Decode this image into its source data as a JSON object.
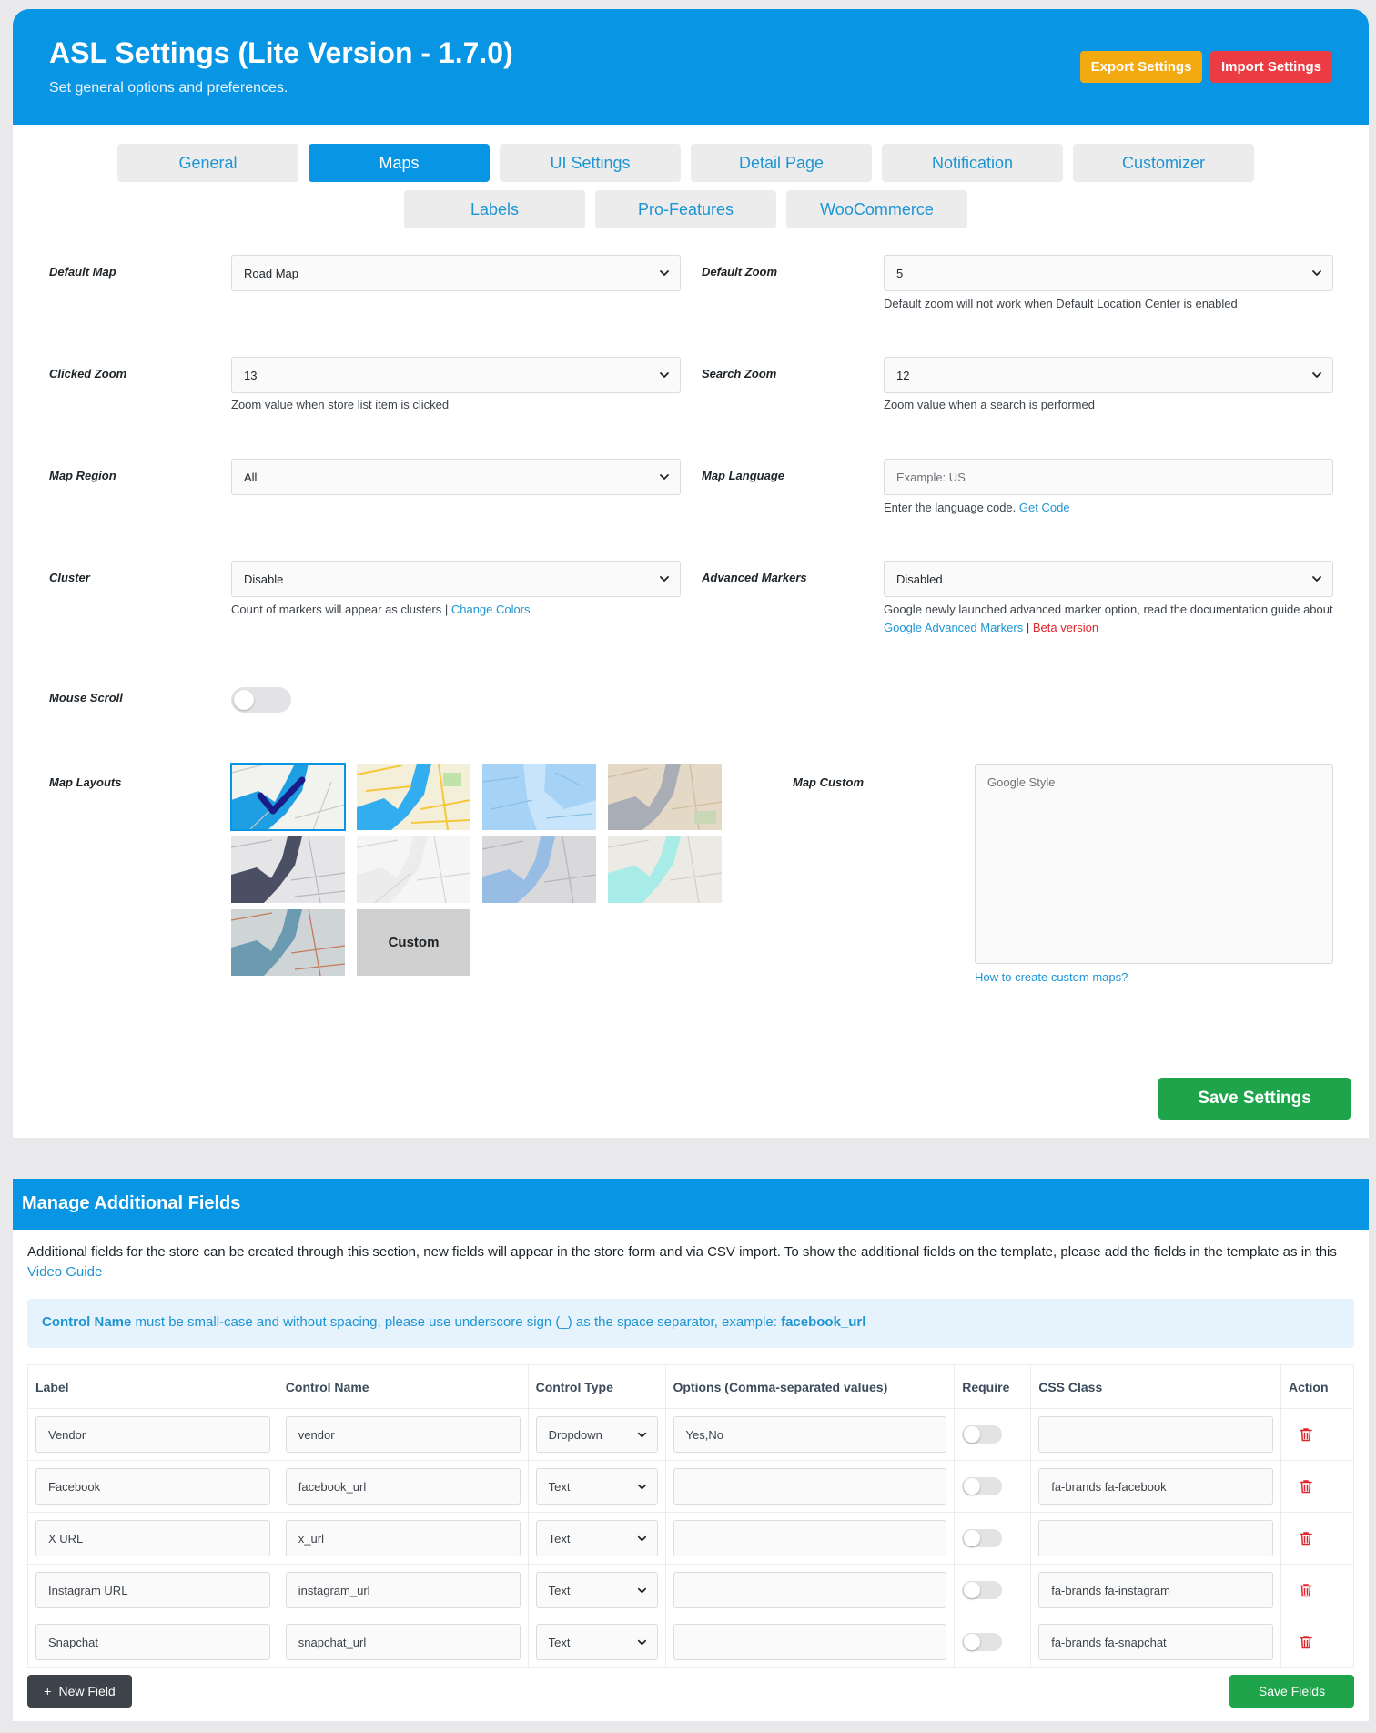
{
  "header": {
    "title": "ASL Settings (Lite Version - 1.7.0)",
    "subtitle": "Set general options and preferences.",
    "export_label": "Export Settings",
    "import_label": "Import Settings",
    "colors": {
      "primary": "#0895e3",
      "export": "#f2aa10",
      "import": "#eb3b43"
    }
  },
  "tabs": {
    "row1": [
      "General",
      "Maps",
      "UI Settings",
      "Detail Page",
      "Notification",
      "Customizer"
    ],
    "row2": [
      "Labels",
      "Pro-Features",
      "WooCommerce"
    ],
    "active": "Maps"
  },
  "maps": {
    "default_map": {
      "label": "Default Map",
      "value": "Road Map"
    },
    "default_zoom": {
      "label": "Default Zoom",
      "value": "5",
      "help": "Default zoom will not work when Default Location Center is enabled"
    },
    "clicked_zoom": {
      "label": "Clicked Zoom",
      "value": "13",
      "help": "Zoom value when store list item is clicked"
    },
    "search_zoom": {
      "label": "Search Zoom",
      "value": "12",
      "help": "Zoom value when a search is performed"
    },
    "map_region": {
      "label": "Map Region",
      "value": "All"
    },
    "map_language": {
      "label": "Map Language",
      "placeholder": "Example: US",
      "help": "Enter the language code.",
      "help_link": "Get Code"
    },
    "cluster": {
      "label": "Cluster",
      "value": "Disable",
      "help": "Count of markers will appear as clusters",
      "separator": "|",
      "help_link": "Change Colors"
    },
    "advanced_markers": {
      "label": "Advanced Markers",
      "value": "Disabled",
      "help": "Google newly launched advanced marker option, read the documentation guide about",
      "help_link": "Google Advanced Markers",
      "separator": "|",
      "help_link2": "Beta version"
    },
    "mouse_scroll": {
      "label": "Mouse Scroll",
      "enabled": false
    },
    "map_layouts": {
      "label": "Map Layouts",
      "custom_tile": "Custom",
      "selected_index": 0
    },
    "map_custom": {
      "label": "Map Custom",
      "placeholder": "Google Style",
      "help_link": "How to create custom maps?"
    },
    "save_label": "Save Settings"
  },
  "fields": {
    "title": "Manage Additional Fields",
    "desc": "Additional fields for the store can be created through this section, new fields will appear in the store form and via CSV import. To show the additional fields on the template, please add the fields in the template as in this",
    "desc_link": "Video Guide",
    "notice_bold": "Control Name",
    "notice_text": "must be small-case and without spacing, please use underscore sign (_) as the space separator, example:",
    "notice_example": "facebook_url",
    "columns": [
      "Label",
      "Control Name",
      "Control Type",
      "Options (Comma-separated values)",
      "Require",
      "CSS Class",
      "Action"
    ],
    "rows": [
      {
        "label": "Vendor",
        "control": "vendor",
        "type": "Dropdown",
        "options": "Yes,No",
        "css": ""
      },
      {
        "label": "Facebook",
        "control": "facebook_url",
        "type": "Text",
        "options": "",
        "css": "fa-brands fa-facebook"
      },
      {
        "label": "X URL",
        "control": "x_url",
        "type": "Text",
        "options": "",
        "css": ""
      },
      {
        "label": "Instagram URL",
        "control": "instagram_url",
        "type": "Text",
        "options": "",
        "css": "fa-brands fa-instagram"
      },
      {
        "label": "Snapchat",
        "control": "snapchat_url",
        "type": "Text",
        "options": "",
        "css": "fa-brands fa-snapchat"
      }
    ],
    "new_label": "New Field",
    "save_label": "Save Fields"
  }
}
